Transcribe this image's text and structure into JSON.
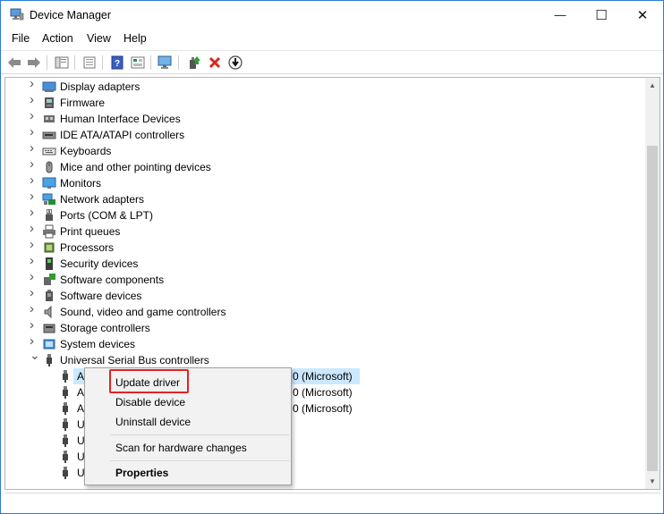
{
  "window": {
    "title": "Device Manager",
    "controls": {
      "minimize": "—",
      "maximize": "☐",
      "close": "✕"
    }
  },
  "menu": {
    "items": [
      "File",
      "Action",
      "View",
      "Help"
    ]
  },
  "toolbar": {
    "buttons": [
      {
        "name": "back-icon"
      },
      {
        "name": "forward-icon"
      },
      {
        "name": "show-hide-tree-icon"
      },
      {
        "name": "properties-icon"
      },
      {
        "name": "help-icon"
      },
      {
        "name": "view-icon"
      },
      {
        "name": "monitor-scan-icon"
      },
      {
        "name": "update-driver-icon"
      },
      {
        "name": "uninstall-icon"
      },
      {
        "name": "download-icon"
      }
    ]
  },
  "tree": {
    "categories": [
      {
        "label": "Display adapters",
        "icon": "display-adapter-icon",
        "expanded": false
      },
      {
        "label": "Firmware",
        "icon": "firmware-icon",
        "expanded": false
      },
      {
        "label": "Human Interface Devices",
        "icon": "hid-icon",
        "expanded": false
      },
      {
        "label": "IDE ATA/ATAPI controllers",
        "icon": "ide-controller-icon",
        "expanded": false
      },
      {
        "label": "Keyboards",
        "icon": "keyboard-icon",
        "expanded": false
      },
      {
        "label": "Mice and other pointing devices",
        "icon": "mouse-icon",
        "expanded": false
      },
      {
        "label": "Monitors",
        "icon": "monitor-icon",
        "expanded": false
      },
      {
        "label": "Network adapters",
        "icon": "network-adapter-icon",
        "expanded": false
      },
      {
        "label": "Ports (COM & LPT)",
        "icon": "port-icon",
        "expanded": false
      },
      {
        "label": "Print queues",
        "icon": "printer-icon",
        "expanded": false
      },
      {
        "label": "Processors",
        "icon": "processor-icon",
        "expanded": false
      },
      {
        "label": "Security devices",
        "icon": "security-device-icon",
        "expanded": false
      },
      {
        "label": "Software components",
        "icon": "software-component-icon",
        "expanded": false
      },
      {
        "label": "Software devices",
        "icon": "software-device-icon",
        "expanded": false
      },
      {
        "label": "Sound, video and game controllers",
        "icon": "speaker-icon",
        "expanded": false
      },
      {
        "label": "Storage controllers",
        "icon": "storage-controller-icon",
        "expanded": false
      },
      {
        "label": "System devices",
        "icon": "system-device-icon",
        "expanded": false
      },
      {
        "label": "Universal Serial Bus controllers",
        "icon": "usb-icon",
        "expanded": true
      }
    ],
    "usb_children": [
      {
        "visible_prefix": "A",
        "visible_suffix": "0 (Microsoft)",
        "selected": true
      },
      {
        "visible_prefix": "A",
        "visible_suffix": "0 (Microsoft)",
        "selected": false
      },
      {
        "visible_prefix": "A",
        "visible_suffix": "0 (Microsoft)",
        "selected": false
      },
      {
        "visible_prefix": "U",
        "visible_suffix": "",
        "selected": false
      },
      {
        "visible_prefix": "U",
        "visible_suffix": "",
        "selected": false
      },
      {
        "visible_prefix": "U",
        "visible_suffix": "",
        "selected": false
      },
      {
        "visible_prefix": "U",
        "visible_suffix": "",
        "selected": false
      }
    ]
  },
  "context_menu": {
    "update_driver": "Update driver",
    "disable_device": "Disable device",
    "uninstall_device": "Uninstall device",
    "scan": "Scan for hardware changes",
    "properties": "Properties"
  },
  "colors": {
    "window_border": "#2b7bd6",
    "selection": "#cce8ff",
    "highlight_box": "#e02424"
  }
}
